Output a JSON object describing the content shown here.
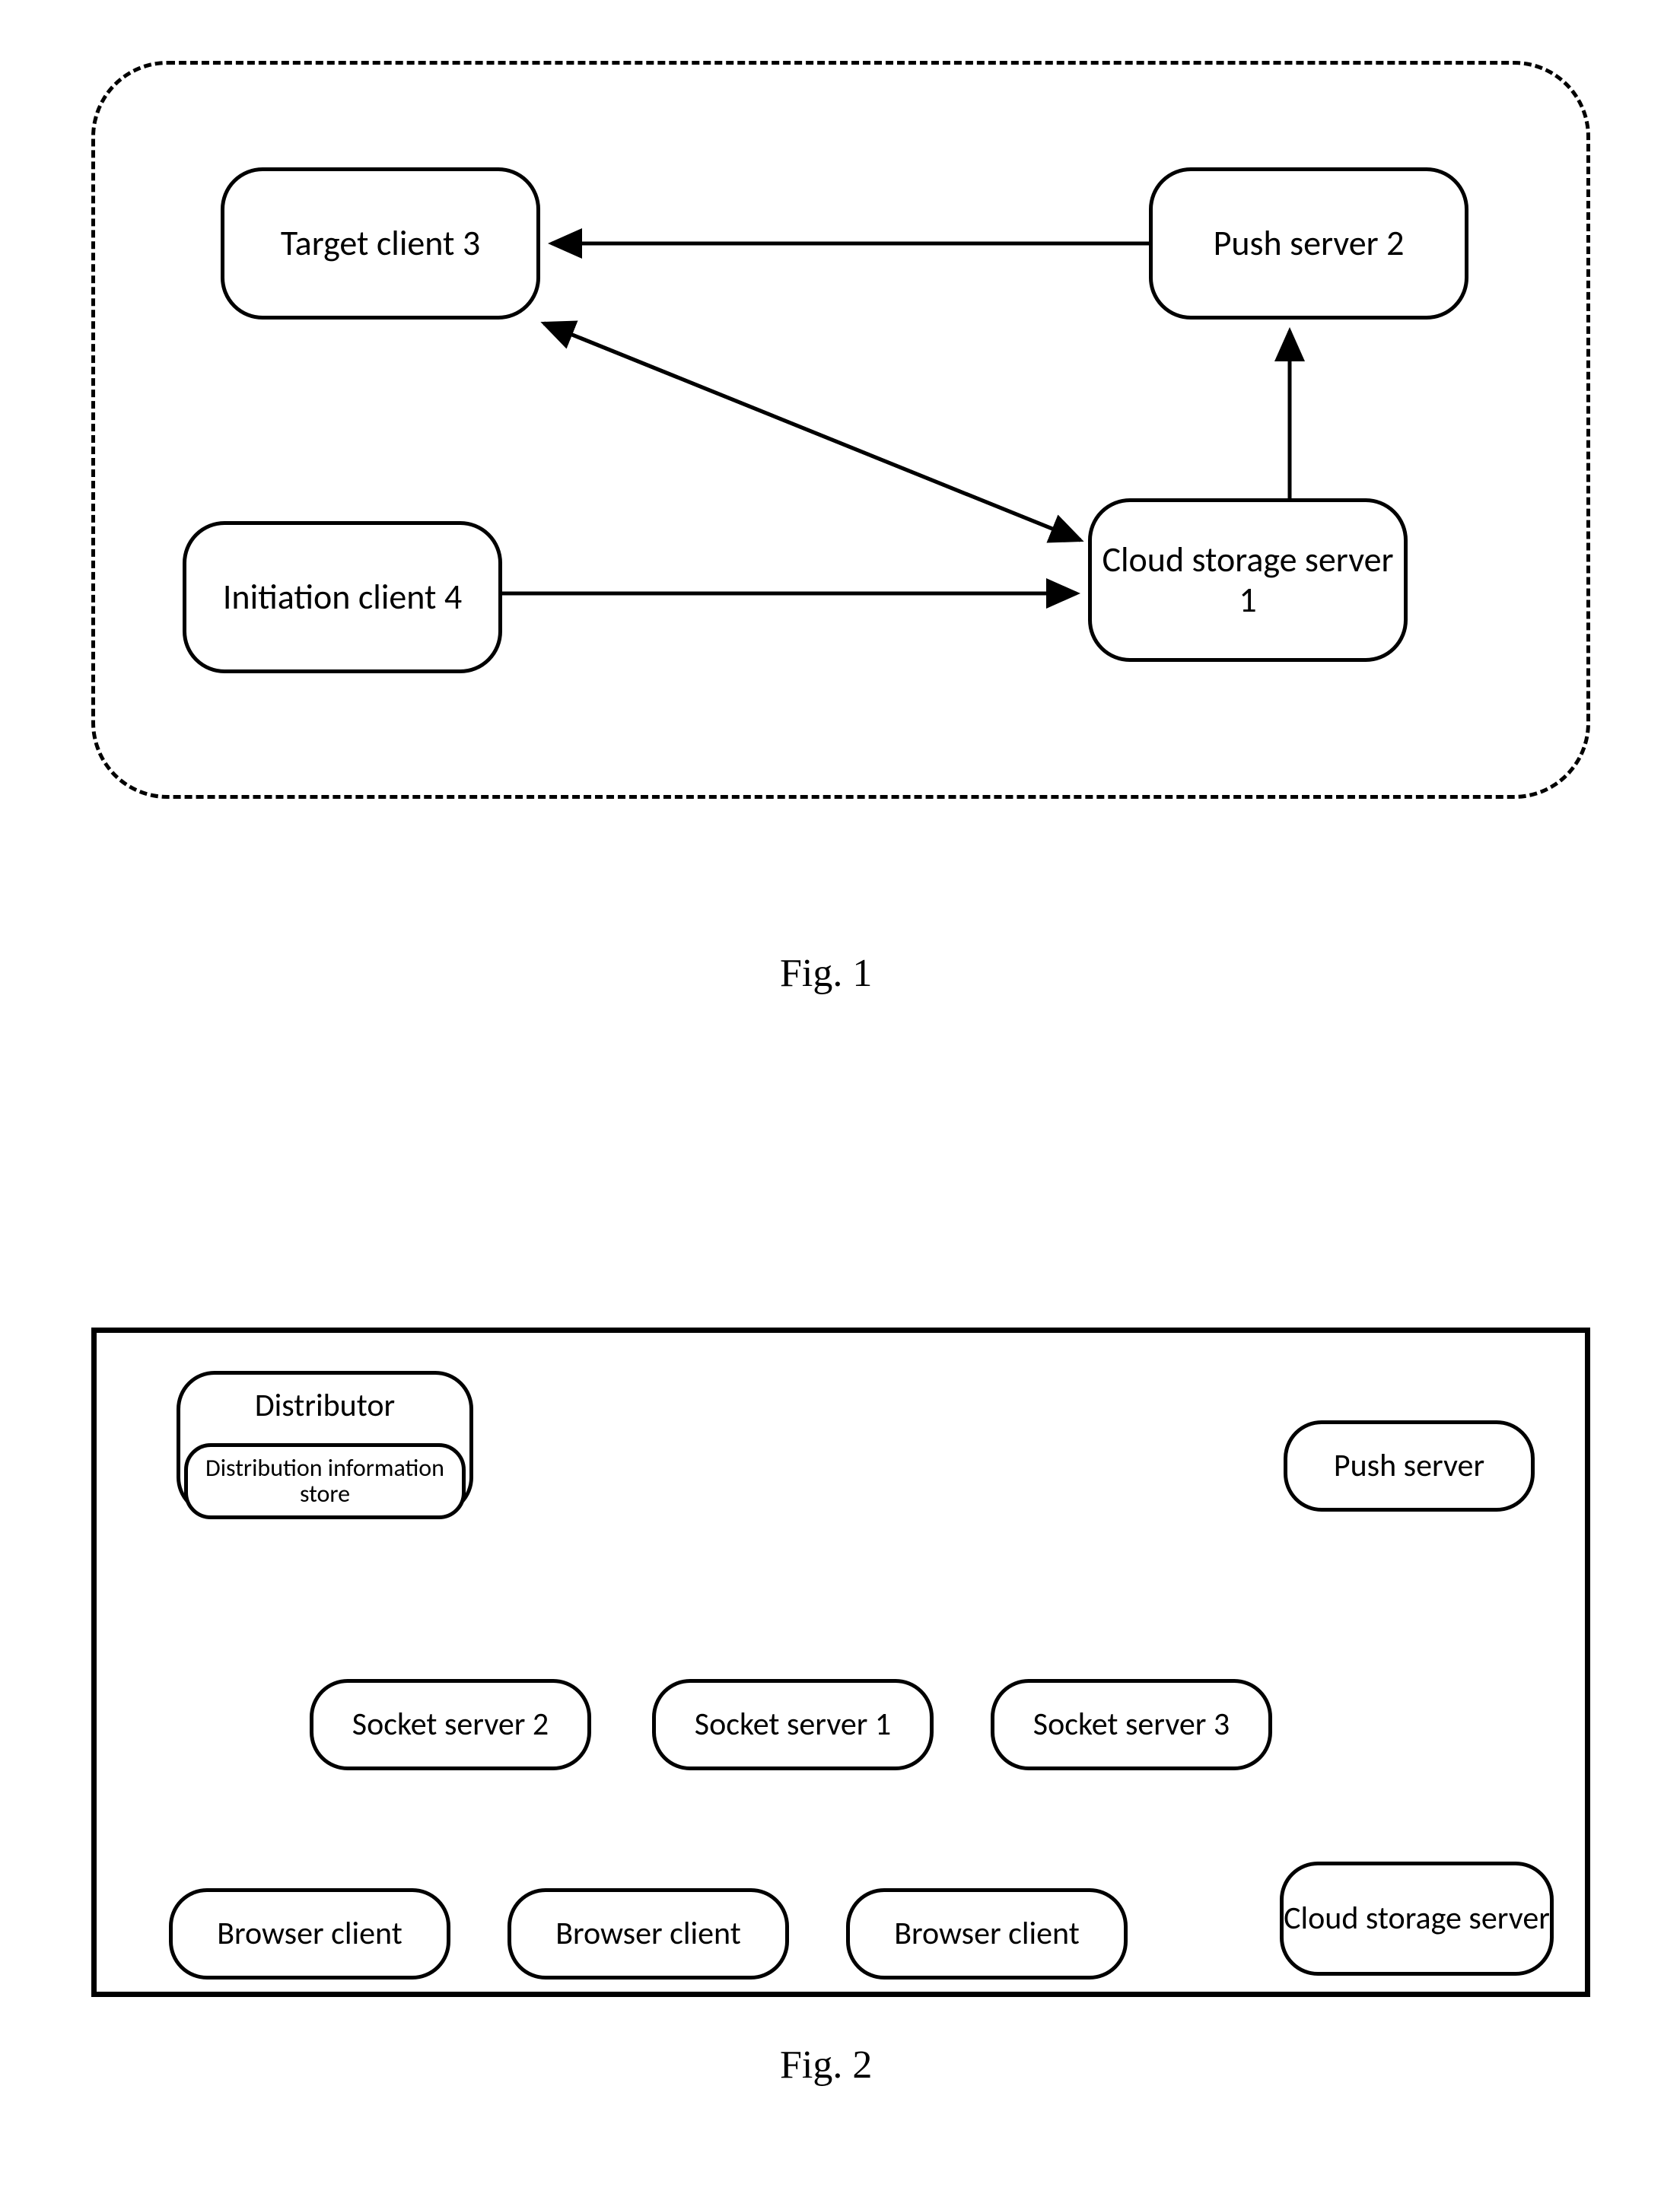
{
  "fig1": {
    "caption": "Fig. 1",
    "nodes": {
      "target_client": "Target client 3",
      "push_server": "Push server 2",
      "initiation_client": "Initiation client 4",
      "cloud_storage": "Cloud storage server 1"
    }
  },
  "fig2": {
    "caption": "Fig. 2",
    "nodes": {
      "distributor": "Distributor",
      "distribution_store": "Distribution information store",
      "push_server": "Push server",
      "socket_server_2": "Socket server 2",
      "socket_server_1": "Socket server 1",
      "socket_server_3": "Socket server 3",
      "browser_client_1": "Browser client",
      "browser_client_2": "Browser client",
      "browser_client_3": "Browser client",
      "cloud_storage": "Cloud storage server"
    }
  }
}
